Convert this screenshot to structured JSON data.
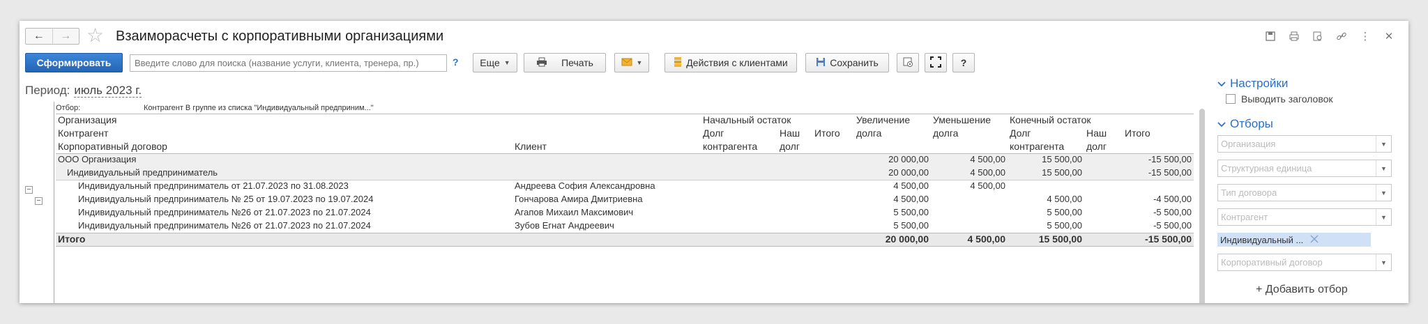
{
  "window": {
    "title": "Взаиморасчеты с корпоративными организациями",
    "nav_back": "←",
    "nav_forward": "→"
  },
  "toolbar": {
    "generate": "Сформировать",
    "search_placeholder": "Введите слово для поиска (название услуги, клиента, тренера, пр.)",
    "help": "?",
    "more": "Еще",
    "print": "Печать",
    "client_actions": "Действия с клиентами",
    "save": "Сохранить",
    "question": "?"
  },
  "period": {
    "label": "Период:",
    "value": "июль 2023 г."
  },
  "report": {
    "filter_label": "Отбор:",
    "filter_value": "Контрагент В группе из списка \"Индивидуальный предприним...\"",
    "headers": {
      "organization": "Организация",
      "contractor": "Контрагент",
      "contract": "Корпоративный договор",
      "client": "Клиент",
      "opening_balance": "Начальный остаток",
      "debt_contractor": "Долг",
      "debt_contractor2": "контрагента",
      "our": "Наш",
      "our_debt": "долг",
      "total": "Итого",
      "increase": "Увеличение",
      "increase2": "долга",
      "decrease": "Уменьшение",
      "decrease2": "долга",
      "closing_balance": "Конечный остаток"
    },
    "groups": [
      {
        "name": "ООО Организация",
        "increase": "20 000,00",
        "decrease": "4 500,00",
        "close_debt": "15 500,00",
        "close_total": "-15 500,00"
      },
      {
        "name": "Индивидуальный предприниматель",
        "increase": "20 000,00",
        "decrease": "4 500,00",
        "close_debt": "15 500,00",
        "close_total": "-15 500,00"
      }
    ],
    "rows": [
      {
        "contract": "Индивидуальный предприниматель  от 21.07.2023 по 31.08.2023",
        "client": "Андреева София Александровна",
        "increase": "4 500,00",
        "decrease": "4 500,00",
        "close_debt": "",
        "close_total": ""
      },
      {
        "contract": "Индивидуальный предприниматель № 25 от 19.07.2023 по 19.07.2024",
        "client": "Гончарова Амира Дмитриевна",
        "increase": "4 500,00",
        "decrease": "",
        "close_debt": "4 500,00",
        "close_total": "-4 500,00"
      },
      {
        "contract": "Индивидуальный предприниматель №26 от 21.07.2023 по 21.07.2024",
        "client": "Агапов Михаил Максимович",
        "increase": "5 500,00",
        "decrease": "",
        "close_debt": "5 500,00",
        "close_total": "-5 500,00"
      },
      {
        "contract": "Индивидуальный предприниматель №26 от 21.07.2023 по 21.07.2024",
        "client": "Зубов Егнат Андреевич",
        "increase": "5 500,00",
        "decrease": "",
        "close_debt": "5 500,00",
        "close_total": "-5 500,00"
      }
    ],
    "totals": {
      "label": "Итого",
      "increase": "20 000,00",
      "decrease": "4 500,00",
      "close_debt": "15 500,00",
      "close_total": "-15 500,00"
    }
  },
  "panel": {
    "settings": "Настройки",
    "show_header": "Выводить заголовок",
    "filters": "Отборы",
    "fields": [
      "Организация",
      "Структурная единица",
      "Тип договора",
      "Контрагент"
    ],
    "selected_tag": "Индивидуальный ...",
    "contract_field": "Корпоративный договор",
    "add_filter": "+ Добавить отбор"
  },
  "colors": {
    "accent": "#2a6fc9",
    "primary_button": "#2465b6"
  }
}
